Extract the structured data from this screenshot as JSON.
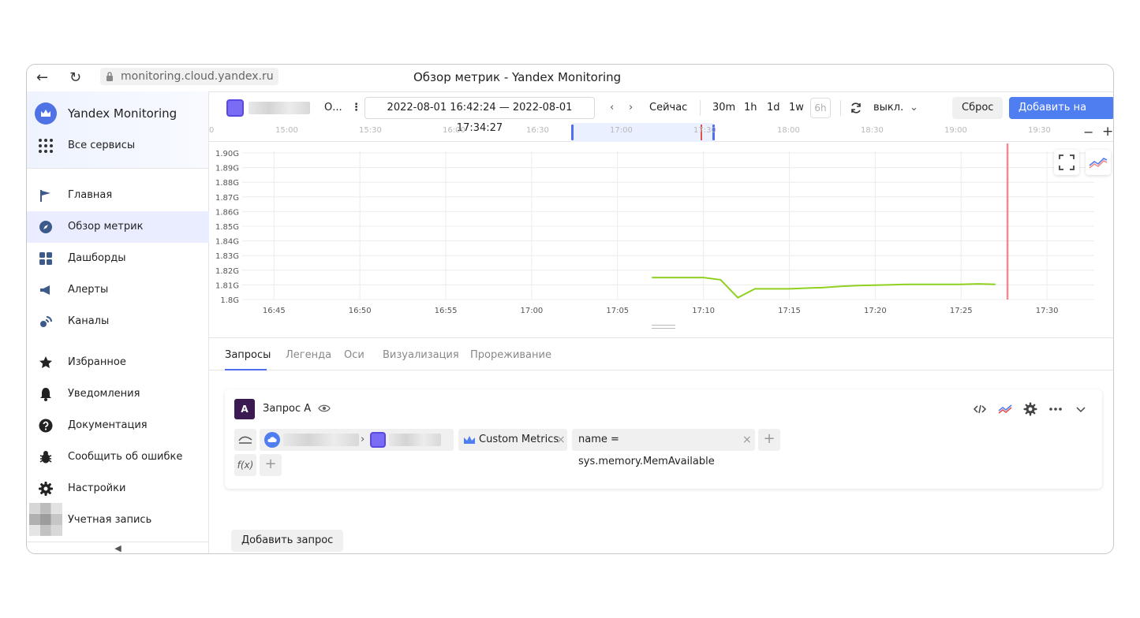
{
  "browser": {
    "url": "monitoring.cloud.yandex.ru",
    "page_title": "Обзор метрик - Yandex Monitoring"
  },
  "sidebar": {
    "brand": "Yandex Monitoring",
    "all_services": "Все сервисы",
    "items": [
      {
        "label": "Главная",
        "icon": "flag-icon",
        "active": false
      },
      {
        "label": "Обзор метрик",
        "icon": "compass-icon",
        "active": true
      },
      {
        "label": "Дашборды",
        "icon": "grid-icon",
        "active": false
      },
      {
        "label": "Алерты",
        "icon": "megaphone-icon",
        "active": false
      },
      {
        "label": "Каналы",
        "icon": "channel-icon",
        "active": false
      },
      {
        "label": "Избранное",
        "icon": "star-icon",
        "active": false
      },
      {
        "label": "Уведомления",
        "icon": "bell-icon",
        "active": false
      },
      {
        "label": "Документация",
        "icon": "help-icon",
        "active": false
      },
      {
        "label": "Сообщить об ошибке",
        "icon": "bug-icon",
        "active": false
      },
      {
        "label": "Настройки",
        "icon": "gear-icon",
        "active": false
      },
      {
        "label": "Учетная запись",
        "icon": "avatar",
        "active": false
      }
    ],
    "collapse": "◀"
  },
  "toolbar": {
    "folder_abbrev": "О...",
    "time_range": "2022-08-01 16:42:24 — 2022-08-01 17:34:27",
    "now": "Сейчас",
    "zooms": [
      "30m",
      "1h",
      "1d",
      "1w",
      "6h"
    ],
    "refresh": "выкл.",
    "reset": "Сброс",
    "add_to_dashboard": "Добавить на дашборд"
  },
  "timeline": {
    "ticks": [
      "15:00",
      "15:30",
      "16:00",
      "16:30",
      "17:00",
      "17:30",
      "18:00",
      "18:30",
      "19:00",
      "19:30"
    ],
    "minus": "−",
    "plus": "+"
  },
  "chart_data": {
    "type": "line",
    "y_ticks": [
      "1.90G",
      "1.89G",
      "1.88G",
      "1.87G",
      "1.86G",
      "1.85G",
      "1.84G",
      "1.83G",
      "1.82G",
      "1.81G",
      "1.8G"
    ],
    "ylim": [
      1.8,
      1.9
    ],
    "x_ticks": [
      "16:45",
      "16:50",
      "16:55",
      "17:00",
      "17:05",
      "17:10",
      "17:15",
      "17:20",
      "17:25",
      "17:30"
    ],
    "x_minutes": [
      45,
      50,
      55,
      60,
      65,
      70,
      75,
      80,
      85,
      90
    ],
    "grid": true,
    "series": [
      {
        "color": "#8fd11e",
        "x": [
          67.0,
          68.0,
          69.0,
          70.0,
          71.0,
          72.0,
          73.0,
          74.0,
          75.0,
          76.0,
          77.0,
          78.0,
          79.0,
          80.0,
          81.0,
          82.0,
          83.0,
          84.0,
          85.0,
          86.0,
          87.0
        ],
        "y": [
          1.815,
          1.815,
          1.815,
          1.815,
          1.8135,
          1.8013,
          1.8073,
          1.8073,
          1.8073,
          1.8078,
          1.8082,
          1.809,
          1.8095,
          1.8098,
          1.8101,
          1.8104,
          1.8104,
          1.8104,
          1.8104,
          1.8107,
          1.8104
        ]
      }
    ],
    "now_marker_x": 87.7,
    "now_color": "#f08a92"
  },
  "tabs": [
    "Запросы",
    "Легенда",
    "Оси",
    "Визуализация",
    "Прореживание"
  ],
  "query": {
    "letter": "A",
    "name": "Запрос А",
    "chip_metrics": "Custom Metrics",
    "chip_name": "name = sys.memory.MemAvailable",
    "fx": "f(x)",
    "plus": "+",
    "close": "×"
  },
  "add_query": "Добавить запрос"
}
